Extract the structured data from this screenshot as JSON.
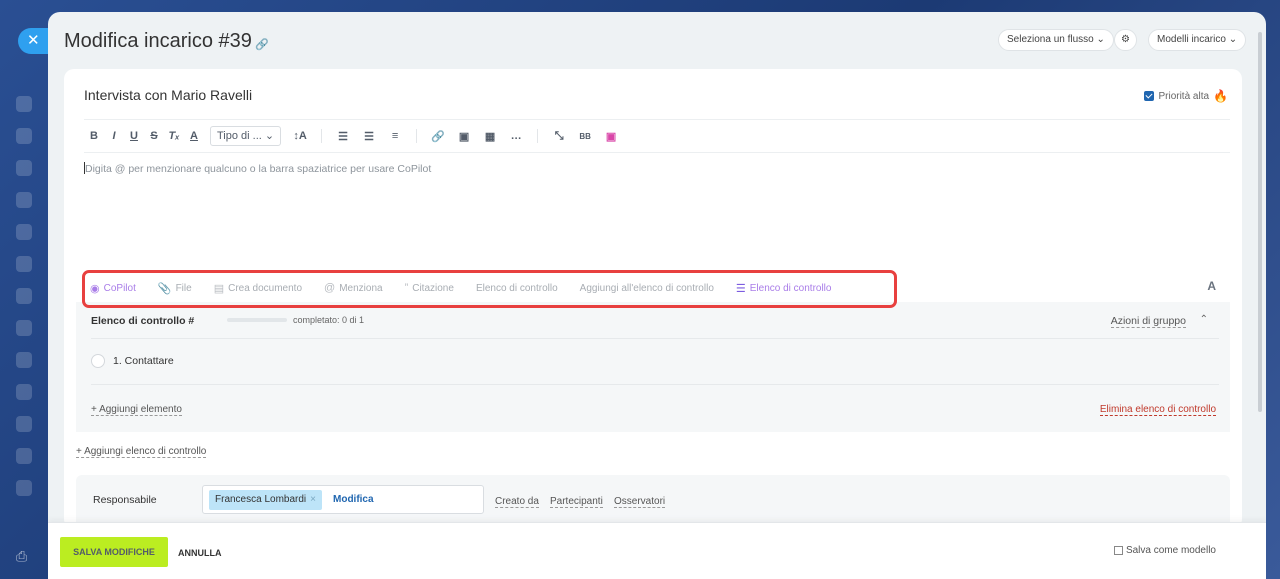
{
  "header": {
    "title": "Modifica incarico #39",
    "flow_button": "Seleziona un flusso ⌄",
    "templates_button": "Modelli incarico ⌄"
  },
  "task": {
    "title": "Intervista con Mario Ravelli",
    "priority_label": "Priorità alta"
  },
  "toolbar": {
    "font_type": "Tipo di ... ⌄"
  },
  "editor": {
    "placeholder": "Digita @ per menzionare qualcuno o la barra spaziatrice per usare CoPilot"
  },
  "actions": [
    {
      "label": "CoPilot",
      "icon": "copilot-icon"
    },
    {
      "label": "File",
      "icon": "paperclip-icon"
    },
    {
      "label": "Crea documento",
      "icon": "document-icon"
    },
    {
      "label": "Menziona",
      "icon": "at-icon"
    },
    {
      "label": "Citazione",
      "icon": "quote-icon"
    },
    {
      "label": "Elenco di controllo",
      "icon": ""
    },
    {
      "label": "Aggiungi all'elenco di controllo",
      "icon": ""
    },
    {
      "label": "Elenco di controllo",
      "icon": "checklist-icon"
    }
  ],
  "checklist": {
    "title": "Elenco di controllo #",
    "progress_completed": 0,
    "progress_total": 1,
    "status": "completato: 0 di 1",
    "group_actions": "Azioni di gruppo",
    "items": [
      {
        "label": "1. Contattare"
      }
    ],
    "add_item": "+ Aggiungi elemento",
    "delete": "Elimina elenco di controllo"
  },
  "add_checklist": "+ Aggiungi elenco di controllo",
  "assignee": {
    "label": "Responsabile",
    "person": "Francesca Lombardi",
    "edit": "Modifica",
    "created_by": "Creato da",
    "participants": "Partecipanti",
    "observers": "Osservatori"
  },
  "footer": {
    "save": "SALVA MODIFICHE",
    "cancel": "ANNULLA",
    "save_template": "Salva come modello"
  },
  "colors": {
    "accent_green": "#bbed21",
    "link_blue": "#2066b0",
    "highlight_red": "#e8403f",
    "copilot_purple": "#a97de8"
  }
}
